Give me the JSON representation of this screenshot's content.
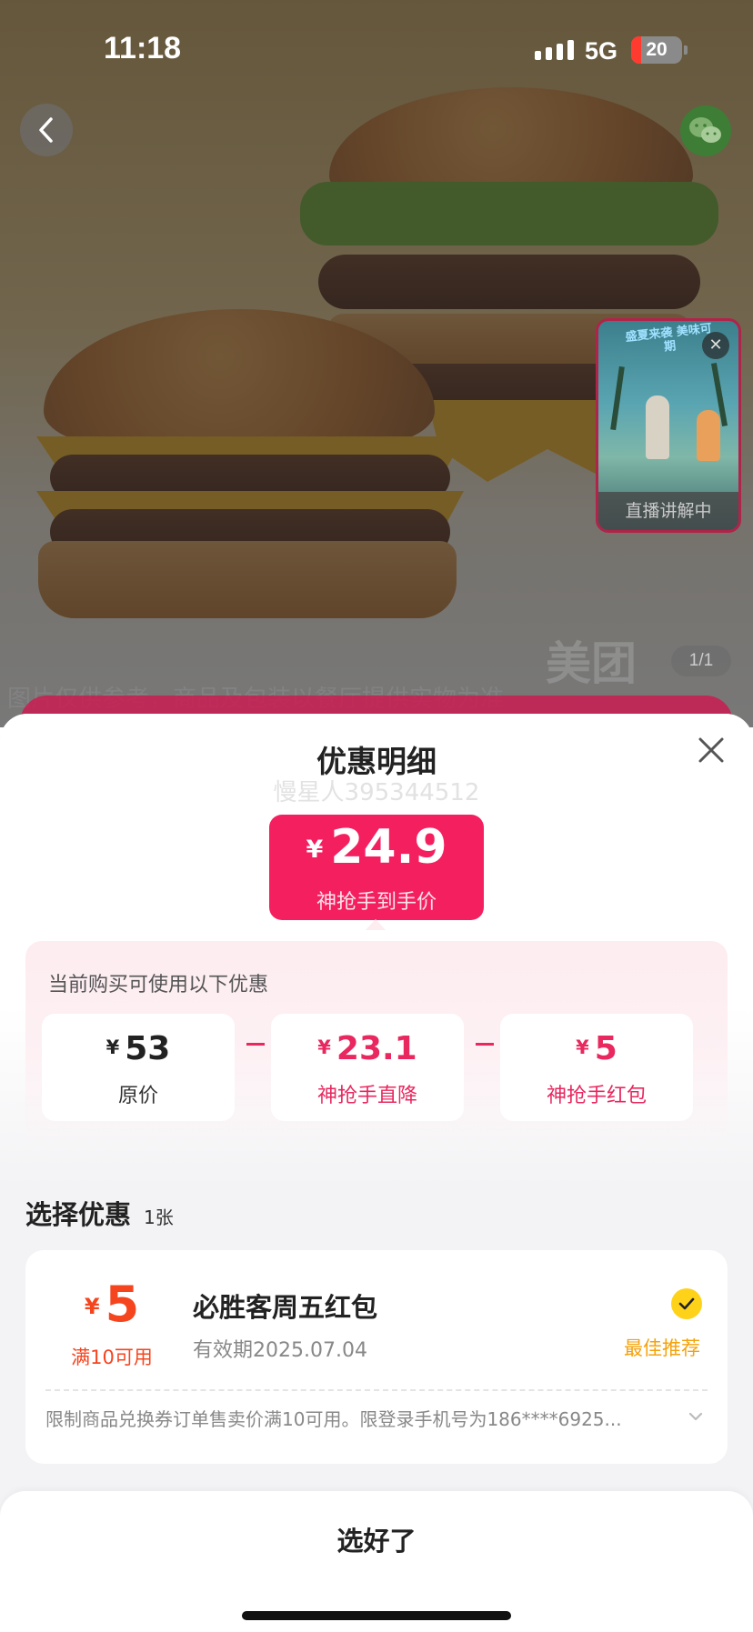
{
  "status_bar": {
    "time": "11:18",
    "network": "5G",
    "battery": "20",
    "battery_level_pct": 20
  },
  "product": {
    "image_counter": "1/1",
    "image_note": "图片仅供参考，商品及包装以餐厅提供实物为准",
    "watermark": "美团",
    "live": {
      "promo": "盛夏来袭 美味可期",
      "label": "直播讲解中"
    }
  },
  "sheet": {
    "title": "优惠明细",
    "watermark": "慢星人395344512",
    "price": {
      "currency": "¥",
      "amount": "24.9",
      "label": "神抢手到手价"
    },
    "discount": {
      "hint": "当前购买可使用以下优惠",
      "items": [
        {
          "currency": "¥",
          "value": "53",
          "label": "原价"
        },
        {
          "currency": "¥",
          "value": "23.1",
          "label": "神抢手直降"
        },
        {
          "currency": "¥",
          "value": "5",
          "label": "神抢手红包"
        }
      ]
    },
    "choose": {
      "title": "选择优惠",
      "count": "1张"
    },
    "coupon": {
      "currency": "¥",
      "value": "5",
      "condition": "满10可用",
      "name": "必胜客周五红包",
      "expiry": "有效期2025.07.04",
      "badge": "最佳推荐",
      "rule": "限制商品兑换券订单售卖价满10可用。限登录手机号为186****6925..."
    },
    "confirm_label": "选好了"
  },
  "colors": {
    "brand_pink": "#f41f5f",
    "coupon_orange": "#f5451f",
    "best_yellow": "#f5a20a",
    "check_yellow": "#ffd21a"
  }
}
